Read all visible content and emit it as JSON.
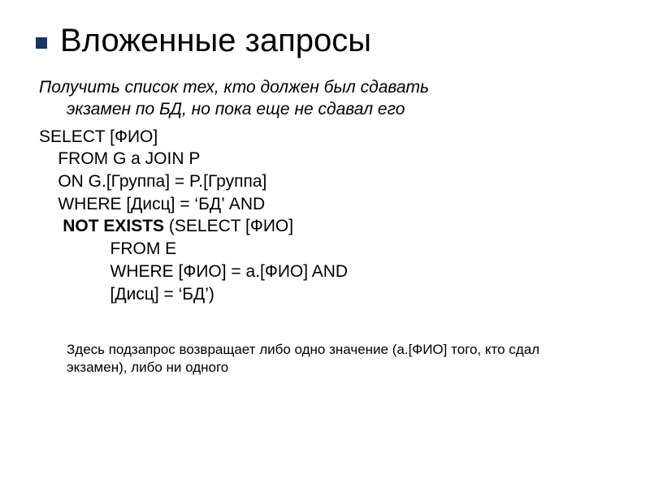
{
  "title": "Вложенные запросы",
  "task_line1": "Получить список тех, кто должен был сдавать",
  "task_line2": "экзамен по БД, но пока еще не сдавал его",
  "sql": {
    "l1": "SELECT [ФИО]",
    "l2": "    FROM G a JOIN P",
    "l3": "    ON G.[Группа] = P.[Группа]",
    "l4": "    WHERE [Дисц] = ‘БД’ AND",
    "l5a": "     ",
    "l5b": "NOT EXISTS",
    "l5c": " (SELECT [ФИО]",
    "l6": "               FROM E",
    "l7": "               WHERE [ФИО] = a.[ФИО] AND",
    "l8": "               [Дисц] = ‘БД’)"
  },
  "subnote": "Здесь подзапрос возвращает либо одно значение (a.[ФИО] того, кто сдал экзамен), либо ни одного"
}
